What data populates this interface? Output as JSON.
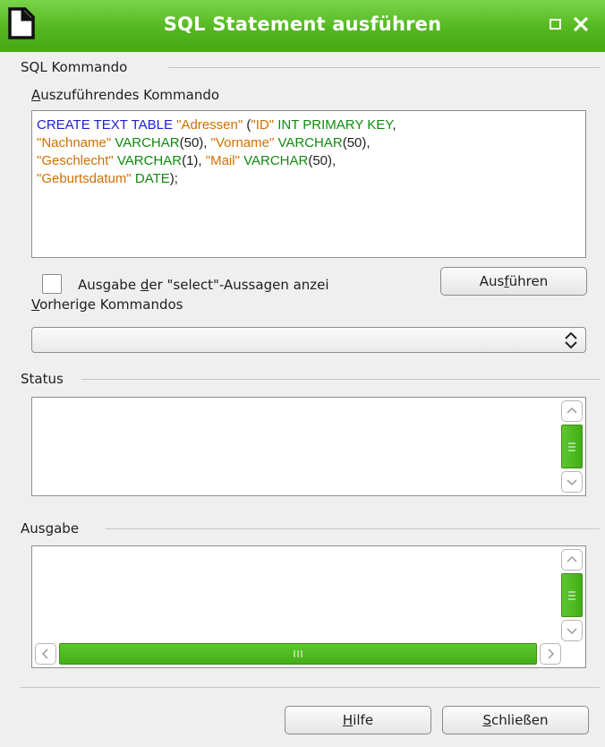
{
  "window": {
    "title": "SQL Statement ausführen",
    "icons": {
      "app": "document-icon",
      "maximize": "maximize-icon",
      "close": "close-icon"
    }
  },
  "sql_section": {
    "label": "SQL Kommando",
    "command_label_accel": "A",
    "command_label_rest": "uszuführendes Kommando",
    "sql_lines": [
      [
        {
          "t": "CREATE TEXT TABLE ",
          "c": "kw"
        },
        {
          "t": "\"Adressen\"",
          "c": "st"
        },
        {
          "t": " (",
          "c": "pl"
        },
        {
          "t": "\"ID\"",
          "c": "st"
        },
        {
          "t": " INT PRIMARY KEY",
          "c": "tp"
        },
        {
          "t": ",",
          "c": "pl"
        }
      ],
      [
        {
          "t": "\"Nachname\"",
          "c": "st"
        },
        {
          "t": " VARCHAR",
          "c": "tp"
        },
        {
          "t": "(50), ",
          "c": "pl"
        },
        {
          "t": "\"Vorname\"",
          "c": "st"
        },
        {
          "t": " VARCHAR",
          "c": "tp"
        },
        {
          "t": "(50),",
          "c": "pl"
        }
      ],
      [
        {
          "t": "\"Geschlecht\"",
          "c": "st"
        },
        {
          "t": " VARCHAR",
          "c": "tp"
        },
        {
          "t": "(1), ",
          "c": "pl"
        },
        {
          "t": "\"Mail\"",
          "c": "st"
        },
        {
          "t": " VARCHAR",
          "c": "tp"
        },
        {
          "t": "(50),",
          "c": "pl"
        }
      ],
      [
        {
          "t": "\"Geburtsdatum\"",
          "c": "st"
        },
        {
          "t": " DATE",
          "c": "tp"
        },
        {
          "t": ");",
          "c": "pl"
        }
      ]
    ],
    "show_select_pre": "Ausgabe ",
    "show_select_accel": "d",
    "show_select_post": "er \"select\"-Aussagen anzei",
    "show_select_checked": false,
    "execute_pre": "Aus",
    "execute_accel": "f",
    "execute_post": "ühren",
    "previous_accel": "V",
    "previous_rest": "orherige Kommandos",
    "previous_value": ""
  },
  "status_section": {
    "label": "Status",
    "text": ""
  },
  "output_section": {
    "label": "Ausgabe",
    "text": ""
  },
  "footer": {
    "help_accel": "H",
    "help_rest": "ilfe",
    "close_accel": "S",
    "close_rest": "chließen"
  },
  "colors": {
    "accent": "#53b81f",
    "keyword": "#2020d0",
    "type": "#108a10",
    "string": "#d07000"
  }
}
